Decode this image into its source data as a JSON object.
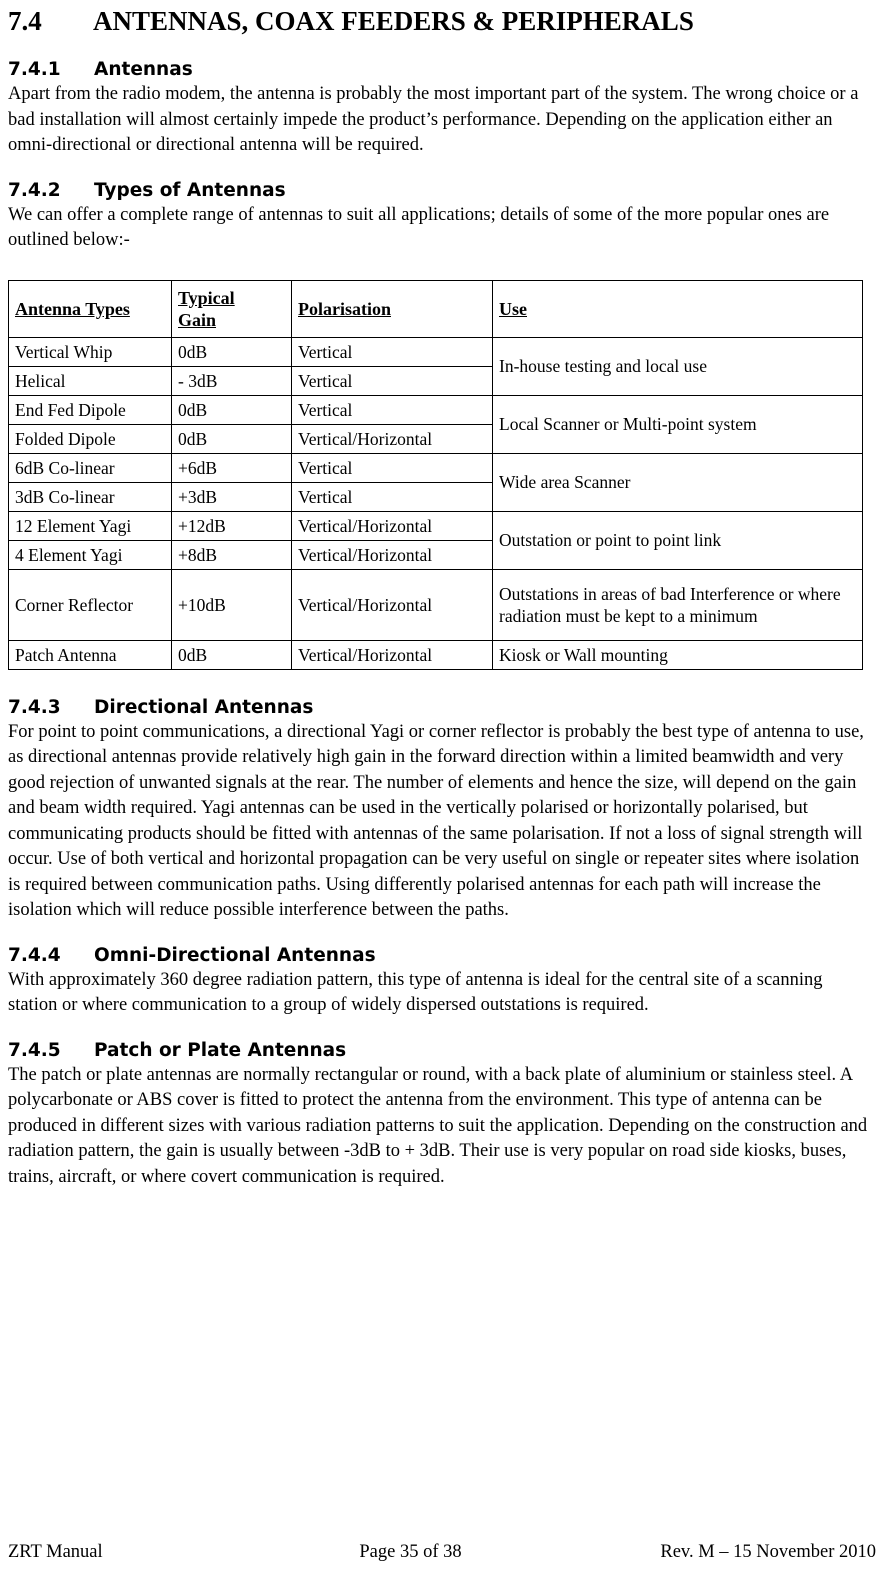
{
  "document": {
    "section_number": "7.4",
    "section_title": "ANTENNAS, COAX FEEDERS & PERIPHERALS"
  },
  "subsections": [
    {
      "number": "7.4.1",
      "title": "Antennas",
      "body": "Apart from the radio modem, the antenna is probably the most important part of the system. The wrong choice or a bad installation will almost certainly impede the product’s performance. Depending on the application either an omni-directional or directional antenna will be required."
    },
    {
      "number": "7.4.2",
      "title": "Types of Antennas",
      "body": "We can offer a complete range of antennas to suit all applications; details of some of the more popular ones are outlined below:-"
    },
    {
      "number": "7.4.3",
      "title": "Directional Antennas",
      "body": "For point to point communications, a directional Yagi or corner reflector is probably the best type of antenna to use, as directional antennas provide relatively high gain in the forward direction within a limited beamwidth and very good rejection of unwanted signals at the rear. The number of elements and hence the size, will depend on the gain and beam width required. Yagi antennas can be used in the vertically polarised or horizontally polarised, but communicating products should be fitted with antennas of the same polarisation.  If not a loss of signal strength will occur. Use of both vertical and horizontal propagation can be very useful on single or repeater sites where isolation is required between communication paths.  Using differently polarised antennas for each path will increase the isolation which will reduce possible interference between the paths."
    },
    {
      "number": "7.4.4",
      "title": "Omni-Directional Antennas",
      "body": "With approximately 360 degree radiation pattern, this type of antenna is ideal for the central site of a scanning station or where communication to a group of widely dispersed outstations is required."
    },
    {
      "number": "7.4.5",
      "title": "Patch or Plate Antennas",
      "body": "The patch or plate antennas are normally rectangular or round, with a back plate of aluminium or stainless steel. A polycarbonate or ABS cover is fitted to protect the antenna from the environment. This type of antenna can be produced in different sizes with various radiation patterns to suit the application. Depending on the construction and radiation pattern, the gain is usually between -3dB to + 3dB. Their use is very popular on road side kiosks, buses, trains, aircraft, or where covert communication is required."
    }
  ],
  "table": {
    "headers": {
      "type": "Antenna Types",
      "gain_line1": "Typical",
      "gain_line2": "Gain",
      "polarisation": "Polarisation",
      "use": "Use"
    },
    "rows": [
      {
        "type": "Vertical Whip",
        "gain": "0dB",
        "polarisation": "Vertical"
      },
      {
        "type": "Helical",
        "gain": "- 3dB",
        "polarisation": "Vertical"
      },
      {
        "type": "End Fed Dipole",
        "gain": "0dB",
        "polarisation": "Vertical"
      },
      {
        "type": "Folded Dipole",
        "gain": "0dB",
        "polarisation": "Vertical/Horizontal"
      },
      {
        "type": "6dB Co-linear",
        "gain": "+6dB",
        "polarisation": "Vertical"
      },
      {
        "type": "3dB Co-linear",
        "gain": "+3dB",
        "polarisation": "Vertical"
      },
      {
        "type": "12 Element Yagi",
        "gain": "+12dB",
        "polarisation": "Vertical/Horizontal"
      },
      {
        "type": " 4 Element Yagi",
        "gain": "+8dB",
        "polarisation": "Vertical/Horizontal"
      },
      {
        "type": "Corner Reflector",
        "gain": "+10dB",
        "polarisation": "Vertical/Horizontal"
      },
      {
        "type": "Patch Antenna",
        "gain": "0dB",
        "polarisation": "Vertical/Horizontal"
      }
    ],
    "use_groups": [
      "In-house testing and local use",
      "Local Scanner or Multi-point system",
      "Wide area Scanner",
      "Outstation or point to point link",
      "Outstations in areas of bad Interference or where radiation must be kept to a minimum",
      "Kiosk or Wall mounting"
    ]
  },
  "footer": {
    "left": "ZRT Manual",
    "center": "Page 35 of 38",
    "right": "Rev. M – 15 November 2010"
  }
}
